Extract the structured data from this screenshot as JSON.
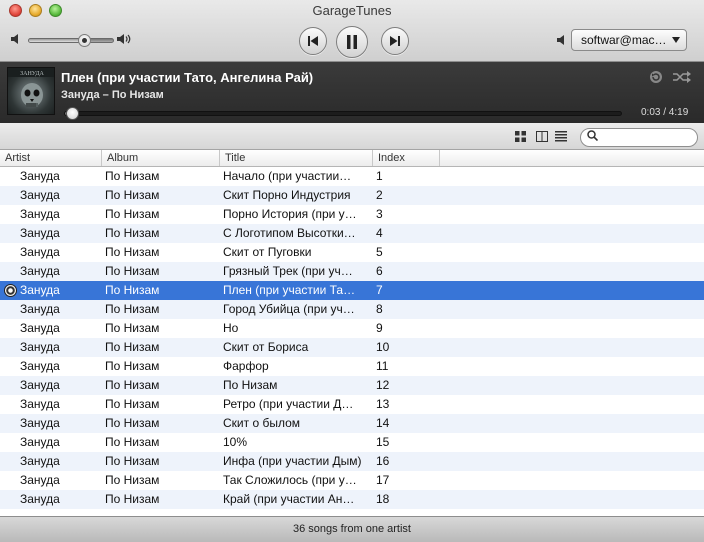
{
  "window": {
    "title": "GarageTunes"
  },
  "toolbar": {
    "volume_level": 0.65,
    "prev_icon": "previous-track-icon",
    "pause_icon": "pause-icon",
    "next_icon": "next-track-icon",
    "device_label": "softwar@mac…",
    "device_icon": "speaker-icon"
  },
  "now_playing": {
    "title": "Плен (при участии Тато, Ангелина Рай)",
    "subtitle": "Зануда – По Низам",
    "time": "0:03 / 4:19",
    "progress": 0.012,
    "repeat_icon": "repeat-icon",
    "shuffle_icon": "shuffle-icon"
  },
  "view": {
    "grid_icon": "grid-view-icon",
    "columns_icon": "column-view-icon",
    "list_icon": "list-view-icon",
    "search_placeholder": ""
  },
  "table": {
    "columns": [
      "Artist",
      "Album",
      "Title",
      "Index"
    ],
    "rows": [
      {
        "artist": "Зануда",
        "album": "По Низам",
        "title": "Начало (при участии…",
        "index": "1"
      },
      {
        "artist": "Зануда",
        "album": "По Низам",
        "title": "Скит Порно Индустрия",
        "index": "2"
      },
      {
        "artist": "Зануда",
        "album": "По Низам",
        "title": "Порно История (при у…",
        "index": "3"
      },
      {
        "artist": "Зануда",
        "album": "По Низам",
        "title": "С Логотипом Высотки…",
        "index": "4"
      },
      {
        "artist": "Зануда",
        "album": "По Низам",
        "title": "Скит от Пуговки",
        "index": "5"
      },
      {
        "artist": "Зануда",
        "album": "По Низам",
        "title": "Грязный Трек (при уч…",
        "index": "6"
      },
      {
        "artist": "Зануда",
        "album": "По Низам",
        "title": "Плен (при участии Та…",
        "index": "7",
        "selected": true
      },
      {
        "artist": "Зануда",
        "album": "По Низам",
        "title": "Город Убийца (при уч…",
        "index": "8"
      },
      {
        "artist": "Зануда",
        "album": "По Низам",
        "title": "Но",
        "index": "9"
      },
      {
        "artist": "Зануда",
        "album": "По Низам",
        "title": "Скит от Бориса",
        "index": "10"
      },
      {
        "artist": "Зануда",
        "album": "По Низам",
        "title": "Фарфор",
        "index": "11"
      },
      {
        "artist": "Зануда",
        "album": "По Низам",
        "title": "По Низам",
        "index": "12"
      },
      {
        "artist": "Зануда",
        "album": "По Низам",
        "title": "Ретро (при участии Д…",
        "index": "13"
      },
      {
        "artist": "Зануда",
        "album": "По Низам",
        "title": "Скит о былом",
        "index": "14"
      },
      {
        "artist": "Зануда",
        "album": "По Низам",
        "title": "10%",
        "index": "15"
      },
      {
        "artist": "Зануда",
        "album": "По Низам",
        "title": "Инфа (при участии Дым)",
        "index": "16"
      },
      {
        "artist": "Зануда",
        "album": "По Низам",
        "title": "Так Сложилось (при у…",
        "index": "17"
      },
      {
        "artist": "Зануда",
        "album": "По Низам",
        "title": "Край (при участии Ан…",
        "index": "18"
      }
    ]
  },
  "status": {
    "text": "36 songs from one artist"
  },
  "colors": {
    "selection": "#3875d7",
    "alt_row": "#eef3fb",
    "now_playing_bg": "#333333"
  }
}
